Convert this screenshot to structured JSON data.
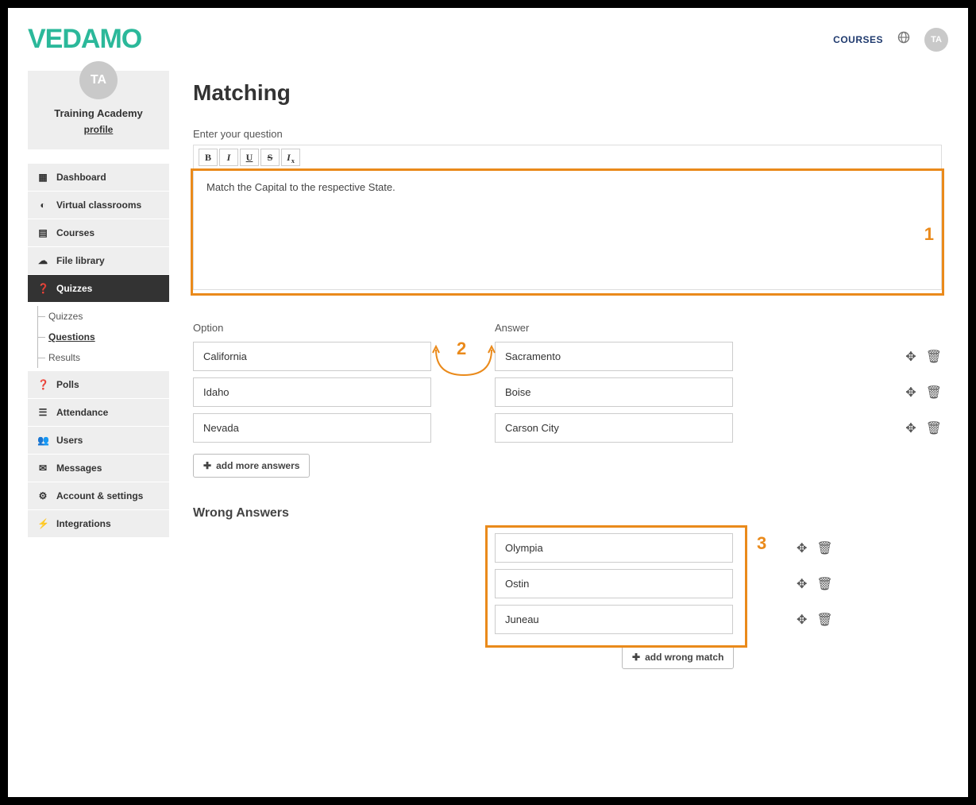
{
  "header": {
    "logo": "VEDAMO",
    "courses_link": "COURSES",
    "avatar_initials": "TA"
  },
  "sidebar": {
    "avatar_initials": "TA",
    "org_name": "Training Academy",
    "profile_link": "profile",
    "items": [
      {
        "icon": "dashboard",
        "label": "Dashboard"
      },
      {
        "icon": "play",
        "label": "Virtual classrooms"
      },
      {
        "icon": "book",
        "label": "Courses"
      },
      {
        "icon": "cloud",
        "label": "File library"
      },
      {
        "icon": "help",
        "label": "Quizzes",
        "active": true
      },
      {
        "icon": "help",
        "label": "Polls"
      },
      {
        "icon": "doc",
        "label": "Attendance"
      },
      {
        "icon": "users",
        "label": "Users"
      },
      {
        "icon": "mail",
        "label": "Messages"
      },
      {
        "icon": "gear",
        "label": "Account & settings"
      },
      {
        "icon": "plug",
        "label": "Integrations"
      }
    ],
    "quiz_sub": [
      "Quizzes",
      "Questions",
      "Results"
    ]
  },
  "main": {
    "title": "Matching",
    "question_label": "Enter your question",
    "toolbar": {
      "bold": "B",
      "italic": "I",
      "underline": "U",
      "strike": "S",
      "clear": "I",
      "clear_sub": "x"
    },
    "question_text": "Match the Capital to the respective State.",
    "option_header": "Option",
    "answer_header": "Answer",
    "pairs": [
      {
        "option": "California",
        "answer": "Sacramento"
      },
      {
        "option": "Idaho",
        "answer": "Boise"
      },
      {
        "option": "Nevada",
        "answer": "Carson City"
      }
    ],
    "add_more_label": "add more answers",
    "wrong_title": "Wrong Answers",
    "wrong": [
      "Olympia",
      "Ostin",
      "Juneau"
    ],
    "add_wrong_label": "add wrong match",
    "annotations": {
      "one": "1",
      "two": "2",
      "three": "3"
    }
  }
}
